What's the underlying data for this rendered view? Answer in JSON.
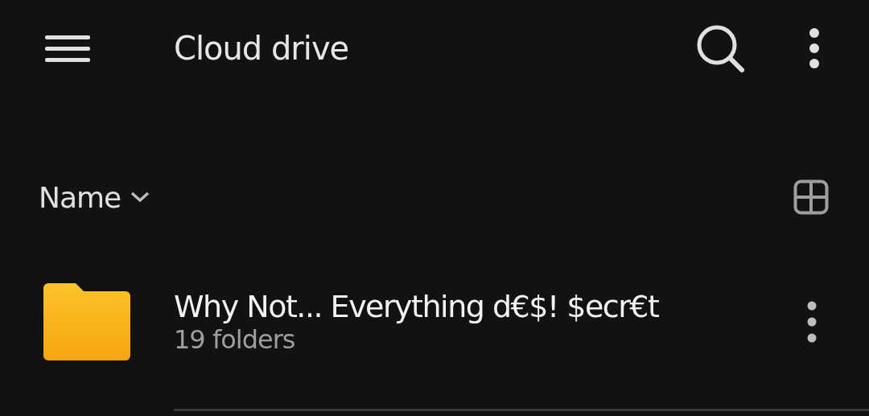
{
  "app_bar": {
    "title": "Cloud drive"
  },
  "sort": {
    "label": "Name"
  },
  "items": [
    {
      "kind": "folder",
      "name": "Why Not... Everything d€$! $ecr€t",
      "subtitle": "19 folders"
    }
  ]
}
